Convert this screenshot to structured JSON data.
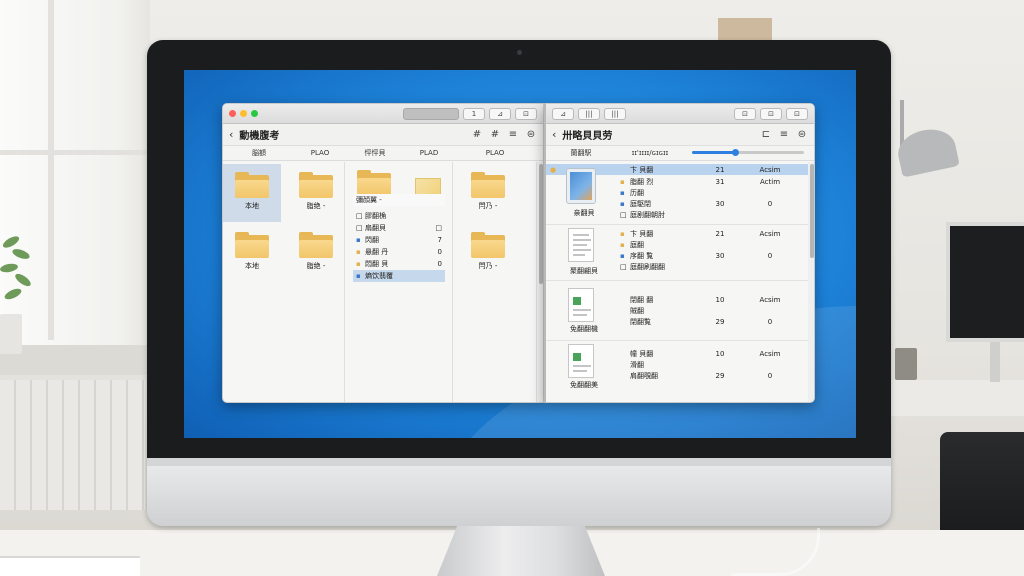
{
  "left_window": {
    "toolbar": {
      "seg1": "",
      "btn1": "1",
      "btn2": "⊿",
      "btn3": "⊡"
    },
    "title": "動機腹考",
    "nav_icons": [
      "#",
      "#",
      "≡",
      "⊜"
    ],
    "columns": [
      "脳額",
      "PLAO",
      "怦怦貝",
      "PLAD",
      "PLAO"
    ],
    "col1_items": [
      {
        "label": "本地"
      },
      {
        "label": "脂绝 -"
      },
      {
        "label": "本地"
      },
      {
        "label": "脂绝 -"
      }
    ],
    "menu_header": "彌顔翼 -",
    "menu_items": [
      {
        "icon": "□",
        "text": "膠翻桷",
        "num": ""
      },
      {
        "icon": "□",
        "text": "扇翻貝",
        "num": "□"
      },
      {
        "icon": "▪",
        "text": "閃翻",
        "num": "7"
      },
      {
        "icon": "▪",
        "text": "悬翻 丹",
        "num": "0"
      },
      {
        "icon": "▪",
        "text": "悶翻 貝",
        "num": "0"
      },
      {
        "icon": "▪",
        "text": "熵饮翡覆",
        "num": ""
      }
    ],
    "col3_items": [
      {
        "label": "閂乃 -"
      },
      {
        "label": "閂乃 -"
      }
    ]
  },
  "right_window": {
    "toolbar": {
      "btn1": "⊿",
      "btn2": "|||",
      "btn3": "|||",
      "btn4": "⊡",
      "btn5": "⊡",
      "btn6": "⊡"
    },
    "title": "卅略貝貝劳",
    "nav_icons": [
      "⊏",
      "≡",
      "⊜"
    ],
    "col_a": "蘭翻駅",
    "col_b": "ɪɪ'ɪɪɪɪ/ɢɪɢɪɪ",
    "zoom_level": 0.38,
    "groups": [
      {
        "thumb": "ipad",
        "label": "亲翻貝",
        "rows": [
          {
            "icon": "●",
            "name": "卞 貝翻",
            "v1": "21",
            "v2": "Acsim"
          },
          {
            "icon": "▪",
            "name": "脂翻 烈",
            "v1": "31",
            "v2": "Actim"
          },
          {
            "icon": "▪",
            "name": "历翻",
            "v1": "",
            "v2": ""
          },
          {
            "icon": "▪",
            "name": "庭駆閉",
            "v1": "30",
            "v2": "0"
          },
          {
            "icon": "□",
            "name": "庭剧翻朝肘",
            "v1": "",
            "v2": ""
          }
        ]
      },
      {
        "thumb": "doc",
        "label": "聚翻翩貝",
        "rows": [
          {
            "icon": "▪",
            "name": "卞 貝翻",
            "v1": "21",
            "v2": "Acsim"
          },
          {
            "icon": "▪",
            "name": "庭翻",
            "v1": "",
            "v2": ""
          },
          {
            "icon": "▪",
            "name": "序翻 覧",
            "v1": "30",
            "v2": "0"
          },
          {
            "icon": "□",
            "name": "庭翻刷翻翻",
            "v1": "",
            "v2": ""
          }
        ]
      },
      {
        "thumb": "sheet",
        "label": "免翻翻機",
        "rows": [
          {
            "icon": "",
            "name": "閉翻 翻",
            "v1": "10",
            "v2": "Acsim"
          },
          {
            "icon": "",
            "name": "賊翻",
            "v1": "",
            "v2": ""
          },
          {
            "icon": "",
            "name": "閉翻覧",
            "v1": "29",
            "v2": "0"
          }
        ]
      },
      {
        "thumb": "sheet",
        "label": "免翻翻美",
        "rows": [
          {
            "icon": "",
            "name": "幢 貝翻",
            "v1": "10",
            "v2": "Acsim"
          },
          {
            "icon": "",
            "name": "滑翻",
            "v1": "",
            "v2": ""
          },
          {
            "icon": "",
            "name": "肩翻覗翻",
            "v1": "29",
            "v2": "0"
          }
        ]
      }
    ]
  },
  "colors": {
    "desktop_blue": "#1d82d8",
    "selection_blue": "#b9d2ee",
    "folder_yellow": "#f2c66a",
    "accent": "#2f7fe0"
  }
}
